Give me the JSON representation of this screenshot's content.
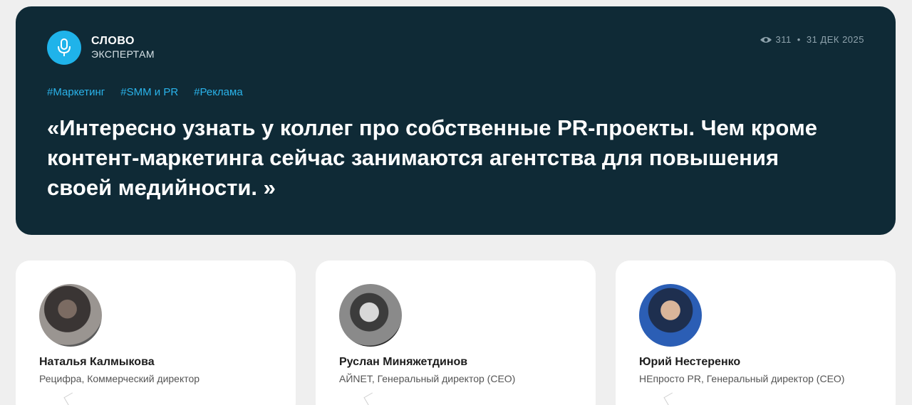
{
  "brand": {
    "line1": "СЛОВО",
    "line2": "ЭКСПЕРТАМ",
    "icon": "microphone-icon",
    "accent": "#1fb3ea"
  },
  "meta": {
    "views": "311",
    "separator": "•",
    "date": "31 ДЕК 2025",
    "icon": "eye-icon"
  },
  "tags": [
    "#Маркетинг",
    "#SMM и PR",
    "#Реклама"
  ],
  "quote": "«Интересно узнать у коллег про собственные PR-проекты. Чем кроме контент-маркетинга сейчас занимаются агентства для повышения своей медийности. »",
  "experts": [
    {
      "name": "Наталья Калмыкова",
      "role": "Рецифра, Коммерческий директор"
    },
    {
      "name": "Руслан Миняжетдинов",
      "role": "АЙNET, Генеральный директор (CEO)"
    },
    {
      "name": "Юрий Нестеренко",
      "role": "НЕпросто PR, Генеральный директор (CEO)"
    }
  ],
  "colors": {
    "hero_bg": "#0f2a36",
    "tag": "#2ab3ea",
    "page_bg": "#efefef"
  }
}
